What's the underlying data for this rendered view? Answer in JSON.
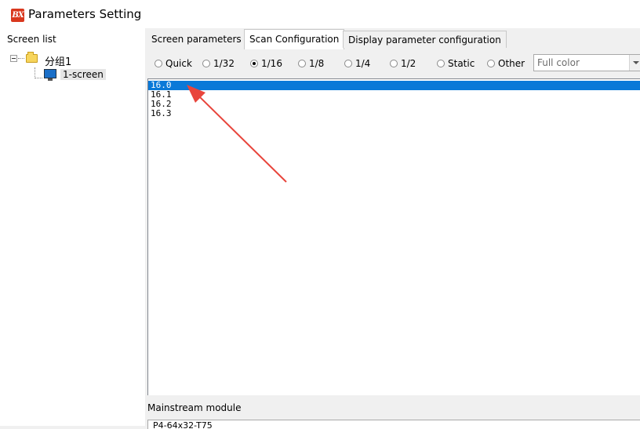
{
  "window": {
    "title": "Parameters Setting",
    "logo_text": "BX"
  },
  "left_pane": {
    "label": "Screen list",
    "tree": {
      "group_label": "分组1",
      "screen_label": "1-screen"
    }
  },
  "tabs": [
    {
      "label": "Screen parameters"
    },
    {
      "label": "Scan Configuration"
    },
    {
      "label": "Display parameter configuration"
    }
  ],
  "scan_modes": [
    {
      "label": "Quick",
      "checked": false
    },
    {
      "label": "1/32",
      "checked": false
    },
    {
      "label": "1/16",
      "checked": true
    },
    {
      "label": "1/8",
      "checked": false
    },
    {
      "label": "1/4",
      "checked": false
    },
    {
      "label": "1/2",
      "checked": false
    },
    {
      "label": "Static",
      "checked": false
    },
    {
      "label": "Other",
      "checked": false
    }
  ],
  "color_select": {
    "value": "Full color"
  },
  "scan_list": {
    "items": [
      "16.0",
      "16.1",
      "16.2",
      "16.3"
    ],
    "selected_index": 0
  },
  "module": {
    "label": "Mainstream module",
    "value": "P4-64x32-T75"
  },
  "colors": {
    "selection": "#0a79d8",
    "annotation_arrow": "#e8453c",
    "logo": "#d9381e"
  }
}
